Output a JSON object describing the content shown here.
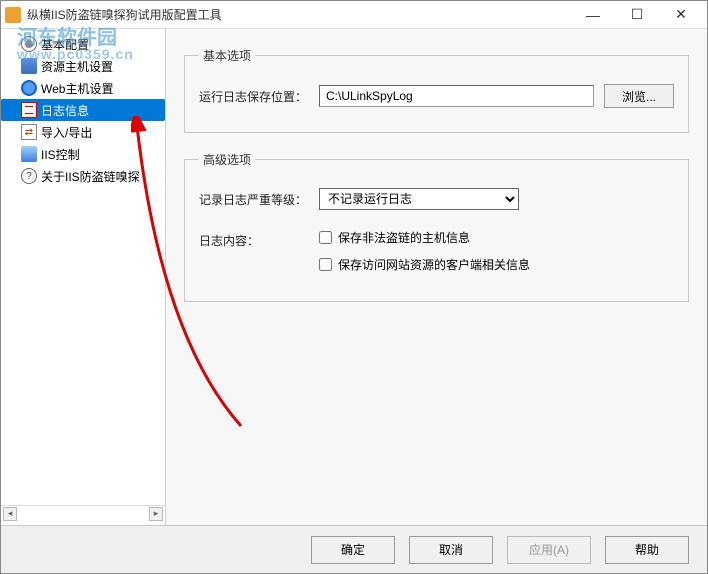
{
  "window": {
    "title": "纵横IIS防盗链嗅探狗试用版配置工具"
  },
  "watermark": {
    "name": "河东软件园",
    "url": "www.pc0359.cn"
  },
  "sidebar": {
    "items": [
      {
        "label": "基本配置",
        "icon": "gear"
      },
      {
        "label": "资源主机设置",
        "icon": "host"
      },
      {
        "label": "Web主机设置",
        "icon": "web"
      },
      {
        "label": "日志信息",
        "icon": "log",
        "selected": true
      },
      {
        "label": "导入/导出",
        "icon": "io"
      },
      {
        "label": "IIS控制",
        "icon": "iis"
      },
      {
        "label": "关于IIS防盗链嗅探",
        "icon": "about"
      }
    ]
  },
  "panels": {
    "basic": {
      "legend": "基本选项",
      "log_path_label": "运行日志保存位置：",
      "log_path_value": "C:\\ULinkSpyLog",
      "browse_label": "浏览..."
    },
    "advanced": {
      "legend": "高级选项",
      "level_label": "记录日志严重等级：",
      "level_value": "不记录运行日志",
      "content_label": "日志内容：",
      "cb1_label": "保存非法盗链的主机信息",
      "cb2_label": "保存访问网站资源的客户端相关信息"
    }
  },
  "buttons": {
    "ok": "确定",
    "cancel": "取消",
    "apply": "应用(A)",
    "help": "帮助"
  }
}
